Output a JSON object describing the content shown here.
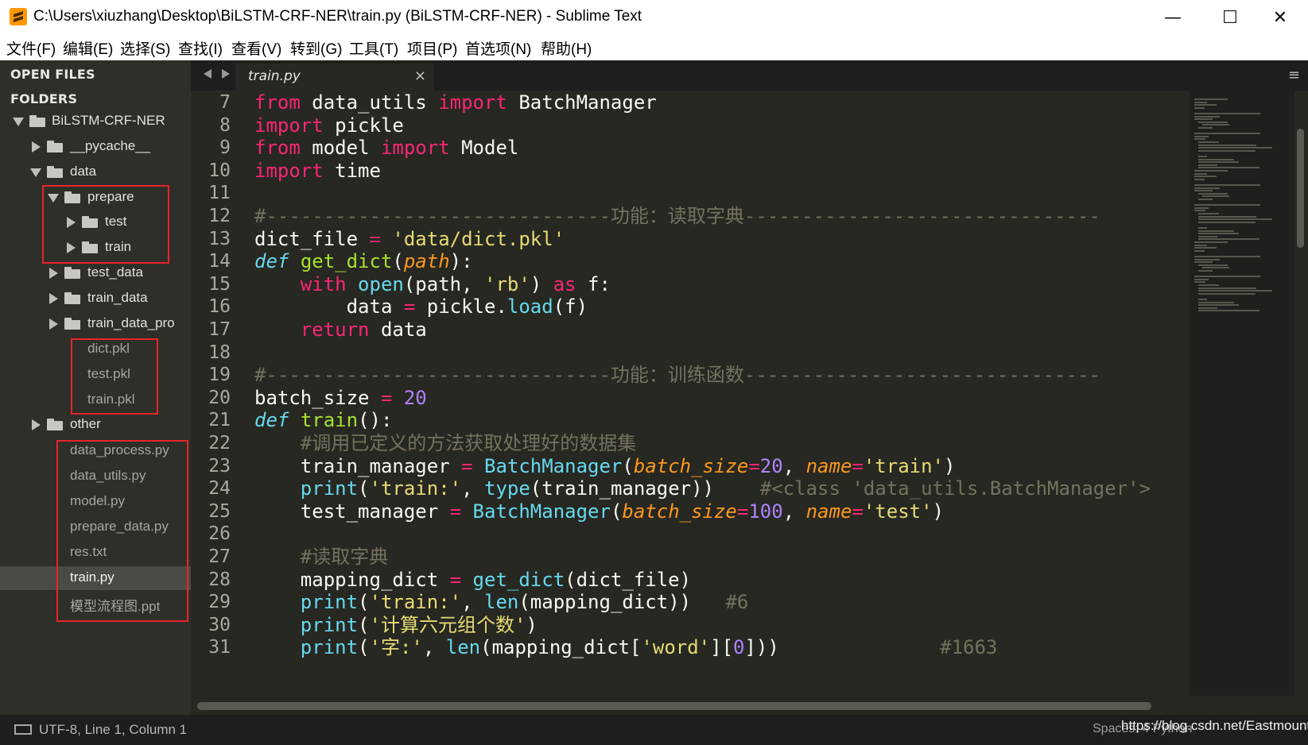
{
  "window": {
    "title": "C:\\Users\\xiuzhang\\Desktop\\BiLSTM-CRF-NER\\train.py (BiLSTM-CRF-NER) - Sublime Text",
    "minimize": "—",
    "maximize": "☐",
    "close": "✕"
  },
  "menu": [
    "文件(F)",
    "编辑(E)",
    "选择(S)",
    "查找(I)",
    "查看(V)",
    "转到(G)",
    "工具(T)",
    "项目(P)",
    "首选项(N)",
    "帮助(H)"
  ],
  "sidebar": {
    "open_files_label": "OPEN FILES",
    "folders_label": "FOLDERS",
    "tree": [
      {
        "label": "BiLSTM-CRF-NER",
        "type": "folder",
        "expanded": true
      },
      {
        "label": "__pycache__",
        "type": "folder",
        "expanded": false
      },
      {
        "label": "data",
        "type": "folder",
        "expanded": true
      },
      {
        "label": "prepare",
        "type": "folder",
        "expanded": true
      },
      {
        "label": "test",
        "type": "folder",
        "expanded": false
      },
      {
        "label": "train",
        "type": "folder",
        "expanded": false
      },
      {
        "label": "test_data",
        "type": "folder",
        "expanded": false
      },
      {
        "label": "train_data",
        "type": "folder",
        "expanded": false
      },
      {
        "label": "train_data_pro",
        "type": "folder",
        "expanded": false
      },
      {
        "label": "dict.pkl",
        "type": "file"
      },
      {
        "label": "test.pkl",
        "type": "file"
      },
      {
        "label": "train.pkl",
        "type": "file"
      },
      {
        "label": "other",
        "type": "folder",
        "expanded": false
      },
      {
        "label": "data_process.py",
        "type": "file"
      },
      {
        "label": "data_utils.py",
        "type": "file"
      },
      {
        "label": "model.py",
        "type": "file"
      },
      {
        "label": "prepare_data.py",
        "type": "file"
      },
      {
        "label": "res.txt",
        "type": "file"
      },
      {
        "label": "train.py",
        "type": "file",
        "selected": true
      },
      {
        "label": "模型流程图.ppt",
        "type": "file"
      }
    ]
  },
  "tabs": {
    "back": "◀",
    "forward": "▶",
    "active_tab": "train.py",
    "close": "×",
    "menu": "≡"
  },
  "editor": {
    "first_line_number": 7,
    "lines": [
      [
        [
          "from",
          "kw"
        ],
        [
          " data_utils ",
          ""
        ],
        [
          "import",
          "kw"
        ],
        [
          " BatchManager",
          ""
        ]
      ],
      [
        [
          "import",
          "kw"
        ],
        [
          " pickle",
          ""
        ]
      ],
      [
        [
          "from",
          "kw"
        ],
        [
          " model ",
          ""
        ],
        [
          "import",
          "kw"
        ],
        [
          " Model",
          ""
        ]
      ],
      [
        [
          "import",
          "kw"
        ],
        [
          " time",
          ""
        ]
      ],
      [],
      [
        [
          "#------------------------------功能：读取字典-------------------------------",
          "cm"
        ]
      ],
      [
        [
          "dict_file ",
          ""
        ],
        [
          "=",
          "op"
        ],
        [
          " ",
          ""
        ],
        [
          "'data/dict.pkl'",
          "str"
        ]
      ],
      [
        [
          "def",
          "def"
        ],
        [
          " ",
          ""
        ],
        [
          "get_dict",
          "fn"
        ],
        [
          "(",
          ""
        ],
        [
          "path",
          "param"
        ],
        [
          "):",
          ""
        ]
      ],
      [
        [
          "    ",
          ""
        ],
        [
          "with",
          "kw"
        ],
        [
          " ",
          ""
        ],
        [
          "open",
          "bi"
        ],
        [
          "(path, ",
          ""
        ],
        [
          "'rb'",
          "str"
        ],
        [
          ") ",
          ""
        ],
        [
          "as",
          "kw"
        ],
        [
          " f:",
          ""
        ]
      ],
      [
        [
          "        data ",
          ""
        ],
        [
          "=",
          "op"
        ],
        [
          " pickle.",
          ""
        ],
        [
          "load",
          "bi"
        ],
        [
          "(f)",
          ""
        ]
      ],
      [
        [
          "    ",
          ""
        ],
        [
          "return",
          "kw"
        ],
        [
          " data",
          ""
        ]
      ],
      [],
      [
        [
          "#------------------------------功能：训练函数-------------------------------",
          "cm"
        ]
      ],
      [
        [
          "batch_size ",
          ""
        ],
        [
          "=",
          "op"
        ],
        [
          " ",
          ""
        ],
        [
          "20",
          "num"
        ]
      ],
      [
        [
          "def",
          "def"
        ],
        [
          " ",
          ""
        ],
        [
          "train",
          "fn"
        ],
        [
          "():",
          ""
        ]
      ],
      [
        [
          "    ",
          ""
        ],
        [
          "#调用已定义的方法获取处理好的数据集",
          "cm"
        ]
      ],
      [
        [
          "    train_manager ",
          ""
        ],
        [
          "=",
          "op"
        ],
        [
          " ",
          ""
        ],
        [
          "BatchManager",
          "bi"
        ],
        [
          "(",
          ""
        ],
        [
          "batch_size",
          "param"
        ],
        [
          "=",
          "op"
        ],
        [
          "20",
          "num"
        ],
        [
          ", ",
          ""
        ],
        [
          "name",
          "param"
        ],
        [
          "=",
          "op"
        ],
        [
          "'train'",
          "str"
        ],
        [
          ")",
          ""
        ]
      ],
      [
        [
          "    ",
          ""
        ],
        [
          "print",
          "bi"
        ],
        [
          "(",
          ""
        ],
        [
          "'train:'",
          "str"
        ],
        [
          ", ",
          ""
        ],
        [
          "type",
          "bi"
        ],
        [
          "(train_manager))    ",
          ""
        ],
        [
          "#<class 'data_utils.BatchManager'>",
          "cm"
        ]
      ],
      [
        [
          "    test_manager ",
          ""
        ],
        [
          "=",
          "op"
        ],
        [
          " ",
          ""
        ],
        [
          "BatchManager",
          "bi"
        ],
        [
          "(",
          ""
        ],
        [
          "batch_size",
          "param"
        ],
        [
          "=",
          "op"
        ],
        [
          "100",
          "num"
        ],
        [
          ", ",
          ""
        ],
        [
          "name",
          "param"
        ],
        [
          "=",
          "op"
        ],
        [
          "'test'",
          "str"
        ],
        [
          ")",
          ""
        ]
      ],
      [],
      [
        [
          "    ",
          ""
        ],
        [
          "#读取字典",
          "cm"
        ]
      ],
      [
        [
          "    mapping_dict ",
          ""
        ],
        [
          "=",
          "op"
        ],
        [
          " ",
          ""
        ],
        [
          "get_dict",
          "bi"
        ],
        [
          "(dict_file)",
          ""
        ]
      ],
      [
        [
          "    ",
          ""
        ],
        [
          "print",
          "bi"
        ],
        [
          "(",
          ""
        ],
        [
          "'train:'",
          "str"
        ],
        [
          ", ",
          ""
        ],
        [
          "len",
          "bi"
        ],
        [
          "(mapping_dict))   ",
          ""
        ],
        [
          "#6",
          "cm"
        ]
      ],
      [
        [
          "    ",
          ""
        ],
        [
          "print",
          "bi"
        ],
        [
          "(",
          ""
        ],
        [
          "'计算六元组个数'",
          "str"
        ],
        [
          ")",
          ""
        ]
      ],
      [
        [
          "    ",
          ""
        ],
        [
          "print",
          "bi"
        ],
        [
          "(",
          ""
        ],
        [
          "'字:'",
          "str"
        ],
        [
          ", ",
          ""
        ],
        [
          "len",
          "bi"
        ],
        [
          "(mapping_dict[",
          ""
        ],
        [
          "'word'",
          "str"
        ],
        [
          "][",
          ""
        ],
        [
          "0",
          "num"
        ],
        [
          "]))              ",
          ""
        ],
        [
          "#1663",
          "cm"
        ]
      ]
    ]
  },
  "status": {
    "left": "UTF-8, Line 1, Column 1",
    "right": "Spaces: 4     Python",
    "watermark": "https://blog.csdn.net/Eastmount"
  },
  "colors": {
    "background": "#272822",
    "sidebar": "#2e2f29",
    "keyword": "#f92672",
    "function": "#a6e22e",
    "builtin": "#66d9ef",
    "string": "#e6db74",
    "number": "#ae81ff",
    "comment": "#75715e",
    "parameter": "#fd971f",
    "highlight_box": "#e8242a"
  }
}
